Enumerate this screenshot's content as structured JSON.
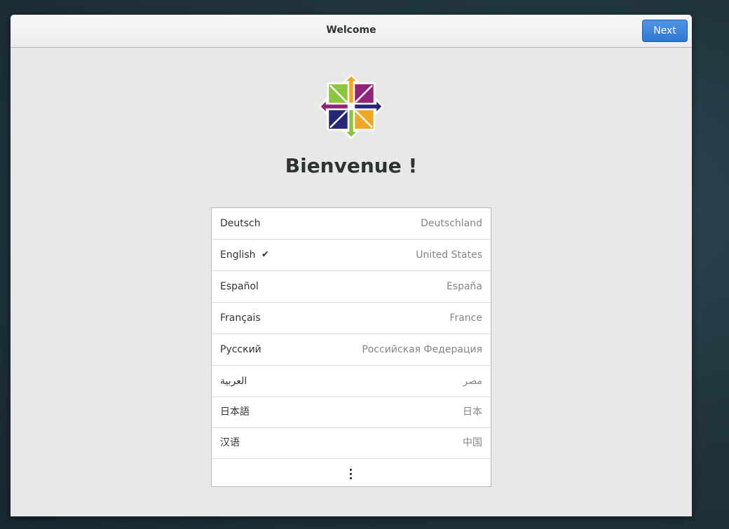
{
  "window": {
    "title": "Welcome",
    "next_label": "Next"
  },
  "welcome": {
    "heading": "Bienvenue !"
  },
  "languages": [
    {
      "language": "Deutsch",
      "region": "Deutschland",
      "selected": false
    },
    {
      "language": "English",
      "region": "United States",
      "selected": true,
      "check": "✔"
    },
    {
      "language": "Español",
      "region": "España",
      "selected": false
    },
    {
      "language": "Français",
      "region": "France",
      "selected": false
    },
    {
      "language": "Русский",
      "region": "Российская Федерация",
      "selected": false
    },
    {
      "language": "العربية",
      "region": "مصر",
      "selected": false
    },
    {
      "language": "日本語",
      "region": "日本",
      "selected": false
    },
    {
      "language": "汉语",
      "region": "中国",
      "selected": false
    }
  ],
  "more": {
    "icon": "view-more-icon"
  },
  "colors": {
    "accent": "#3b82dc",
    "logo_green": "#8cc63f",
    "logo_purple": "#932279",
    "logo_orange": "#efa724",
    "logo_navy": "#262577"
  }
}
